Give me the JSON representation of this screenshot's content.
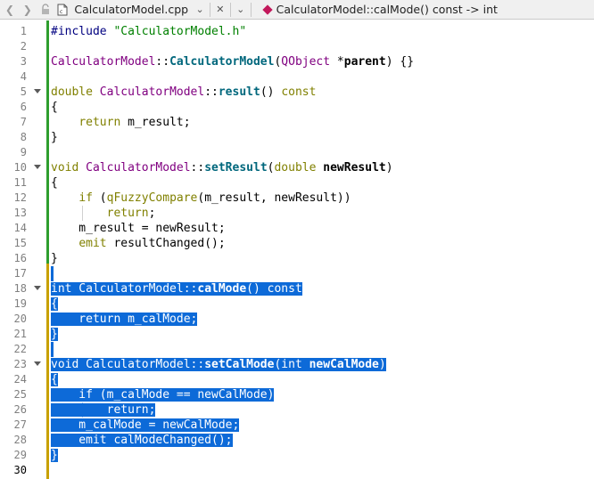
{
  "toolbar": {
    "file_name": "CalculatorModel.cpp",
    "function_name": "CalculatorModel::calMode() const -> int",
    "icons": [
      "back-arrow-icon",
      "forward-arrow-icon",
      "lock-icon",
      "file-icon",
      "chevron-down-icon",
      "close-icon",
      "chevron-down-icon",
      "function-icon"
    ]
  },
  "colors": {
    "selection": "#0d6ad8",
    "change_bar_saved": "#2e9e2e",
    "change_bar_modified": "#c8a000",
    "keyword": "#808000",
    "type": "#800080",
    "function": "#00677c"
  },
  "editor": {
    "current_line": 30,
    "lines": [
      {
        "n": "1",
        "fold": false,
        "sel": false,
        "guide": false,
        "segs": [
          {
            "t": "#include ",
            "c": "pp"
          },
          {
            "t": "\"CalculatorModel.h\"",
            "c": "str"
          }
        ]
      },
      {
        "n": "2",
        "fold": false,
        "sel": false,
        "guide": false,
        "segs": []
      },
      {
        "n": "3",
        "fold": false,
        "sel": false,
        "guide": false,
        "segs": [
          {
            "t": "CalculatorModel",
            "c": "cls"
          },
          {
            "t": "::",
            "c": ""
          },
          {
            "t": "CalculatorModel",
            "c": "fn"
          },
          {
            "t": "(",
            "c": ""
          },
          {
            "t": "QObject",
            "c": "cls"
          },
          {
            "t": " *",
            "c": ""
          },
          {
            "t": "parent",
            "c": "b"
          },
          {
            "t": ") {}",
            "c": ""
          }
        ]
      },
      {
        "n": "4",
        "fold": false,
        "sel": false,
        "guide": false,
        "segs": []
      },
      {
        "n": "5",
        "fold": true,
        "sel": false,
        "guide": false,
        "segs": [
          {
            "t": "double",
            "c": "kw"
          },
          {
            "t": " ",
            "c": ""
          },
          {
            "t": "CalculatorModel",
            "c": "cls"
          },
          {
            "t": "::",
            "c": ""
          },
          {
            "t": "result",
            "c": "fn"
          },
          {
            "t": "() ",
            "c": ""
          },
          {
            "t": "const",
            "c": "kw"
          }
        ]
      },
      {
        "n": "6",
        "fold": false,
        "sel": false,
        "guide": false,
        "segs": [
          {
            "t": "{",
            "c": ""
          }
        ]
      },
      {
        "n": "7",
        "fold": false,
        "sel": false,
        "guide": false,
        "segs": [
          {
            "t": "    ",
            "c": ""
          },
          {
            "t": "return",
            "c": "kw"
          },
          {
            "t": " m_result;",
            "c": ""
          }
        ]
      },
      {
        "n": "8",
        "fold": false,
        "sel": false,
        "guide": false,
        "segs": [
          {
            "t": "}",
            "c": ""
          }
        ]
      },
      {
        "n": "9",
        "fold": false,
        "sel": false,
        "guide": false,
        "segs": []
      },
      {
        "n": "10",
        "fold": true,
        "sel": false,
        "guide": false,
        "segs": [
          {
            "t": "void",
            "c": "kw"
          },
          {
            "t": " ",
            "c": ""
          },
          {
            "t": "CalculatorModel",
            "c": "cls"
          },
          {
            "t": "::",
            "c": ""
          },
          {
            "t": "setResult",
            "c": "fn"
          },
          {
            "t": "(",
            "c": ""
          },
          {
            "t": "double",
            "c": "kw"
          },
          {
            "t": " ",
            "c": ""
          },
          {
            "t": "newResult",
            "c": "b"
          },
          {
            "t": ")",
            "c": ""
          }
        ]
      },
      {
        "n": "11",
        "fold": false,
        "sel": false,
        "guide": false,
        "segs": [
          {
            "t": "{",
            "c": ""
          }
        ]
      },
      {
        "n": "12",
        "fold": false,
        "sel": false,
        "guide": false,
        "segs": [
          {
            "t": "    ",
            "c": ""
          },
          {
            "t": "if",
            "c": "kw"
          },
          {
            "t": " (",
            "c": ""
          },
          {
            "t": "qFuzzyCompare",
            "c": "kw"
          },
          {
            "t": "(m_result, newResult))",
            "c": ""
          }
        ]
      },
      {
        "n": "13",
        "fold": false,
        "sel": false,
        "guide": true,
        "segs": [
          {
            "t": "        ",
            "c": ""
          },
          {
            "t": "return",
            "c": "kw"
          },
          {
            "t": ";",
            "c": ""
          }
        ]
      },
      {
        "n": "14",
        "fold": false,
        "sel": false,
        "guide": false,
        "segs": [
          {
            "t": "    m_result = newResult;",
            "c": ""
          }
        ]
      },
      {
        "n": "15",
        "fold": false,
        "sel": false,
        "guide": false,
        "segs": [
          {
            "t": "    ",
            "c": ""
          },
          {
            "t": "emit",
            "c": "kw"
          },
          {
            "t": " resultChanged();",
            "c": ""
          }
        ]
      },
      {
        "n": "16",
        "fold": false,
        "sel": false,
        "guide": false,
        "segs": [
          {
            "t": "}",
            "c": ""
          }
        ]
      },
      {
        "n": "17",
        "fold": false,
        "sel": true,
        "guide": false,
        "segs": []
      },
      {
        "n": "18",
        "fold": true,
        "sel": true,
        "guide": false,
        "segs": [
          {
            "t": "int CalculatorModel::",
            "c": ""
          },
          {
            "t": "calMode",
            "c": "b"
          },
          {
            "t": "() const",
            "c": ""
          }
        ]
      },
      {
        "n": "19",
        "fold": false,
        "sel": true,
        "guide": false,
        "segs": [
          {
            "t": "{",
            "c": ""
          }
        ]
      },
      {
        "n": "20",
        "fold": false,
        "sel": true,
        "guide": false,
        "segs": [
          {
            "t": "    return m_calMode;",
            "c": ""
          }
        ]
      },
      {
        "n": "21",
        "fold": false,
        "sel": true,
        "guide": false,
        "segs": [
          {
            "t": "}",
            "c": ""
          }
        ]
      },
      {
        "n": "22",
        "fold": false,
        "sel": true,
        "guide": false,
        "segs": []
      },
      {
        "n": "23",
        "fold": true,
        "sel": true,
        "guide": false,
        "segs": [
          {
            "t": "void CalculatorModel::",
            "c": ""
          },
          {
            "t": "setCalMode",
            "c": "b"
          },
          {
            "t": "(int ",
            "c": ""
          },
          {
            "t": "newCalMode",
            "c": "b"
          },
          {
            "t": ")",
            "c": ""
          }
        ]
      },
      {
        "n": "24",
        "fold": false,
        "sel": true,
        "guide": false,
        "segs": [
          {
            "t": "{",
            "c": ""
          }
        ]
      },
      {
        "n": "25",
        "fold": false,
        "sel": true,
        "guide": false,
        "segs": [
          {
            "t": "    if (m_calMode == newCalMode)",
            "c": ""
          }
        ]
      },
      {
        "n": "26",
        "fold": false,
        "sel": true,
        "guide": true,
        "segs": [
          {
            "t": "        return;",
            "c": ""
          }
        ]
      },
      {
        "n": "27",
        "fold": false,
        "sel": true,
        "guide": false,
        "segs": [
          {
            "t": "    m_calMode = newCalMode;",
            "c": ""
          }
        ]
      },
      {
        "n": "28",
        "fold": false,
        "sel": true,
        "guide": false,
        "segs": [
          {
            "t": "    emit calModeChanged();",
            "c": ""
          }
        ]
      },
      {
        "n": "29",
        "fold": false,
        "sel": true,
        "guide": false,
        "segs": [
          {
            "t": "}",
            "c": ""
          }
        ]
      },
      {
        "n": "30",
        "fold": false,
        "sel": false,
        "guide": false,
        "segs": []
      }
    ]
  }
}
